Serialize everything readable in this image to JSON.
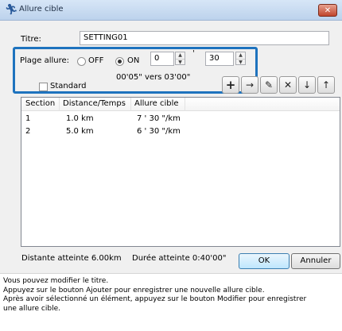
{
  "window": {
    "title": "Allure cible",
    "close_icon": "close-icon",
    "app_icon": "runner-icon"
  },
  "form": {
    "title_label": "Titre:",
    "title_value": "SETTING01",
    "plage_label": "Plage allure:",
    "off_label": "OFF",
    "on_label": "ON",
    "min_value": "0",
    "minute_mark": "'",
    "sec_value": "30",
    "standard_label": "Standard",
    "range_text": "00'05\" vers 03'00\"",
    "selected_mode": "ON",
    "standard_checked": false
  },
  "toolbar": {
    "add_symbol": "+",
    "arrow_symbol": "→",
    "edit_symbol": "✎",
    "delete_symbol": "✕",
    "down_symbol": "↓",
    "up_symbol": "↑"
  },
  "table": {
    "headers": [
      "Section",
      "Distance/Temps",
      "Allure cible"
    ],
    "rows": [
      [
        "1",
        "1.0 km",
        "7 ' 30 \"/km"
      ],
      [
        "2",
        "5.0 km",
        "6 ' 30 \"/km"
      ]
    ]
  },
  "status": {
    "distance_text": "Distante atteinte 6.00km",
    "duration_text": "Durée atteinte 0:40'00\""
  },
  "buttons": {
    "ok": "OK",
    "cancel": "Annuler"
  },
  "help": [
    "Vous pouvez modifier le titre.",
    "Appuyez sur le bouton Ajouter pour enregistrer une nouvelle allure cible.",
    "Après avoir sélectionné un élément, appuyez sur le bouton Modifier pour enregistrer",
    "une allure cible."
  ]
}
